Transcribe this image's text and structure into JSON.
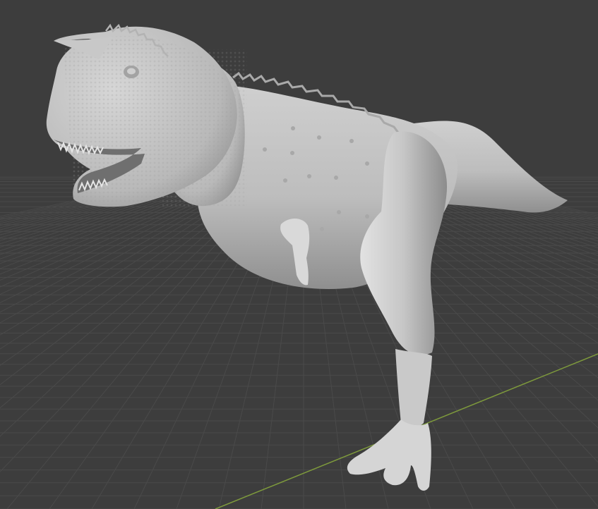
{
  "viewport": {
    "background_color": "#3d3d3d",
    "grid_line_color": "#4a4a4a",
    "x_axis_color": "#7e9a3c",
    "model_color": "#c4c4c4",
    "model_shadow_color": "#8a8a8a",
    "model_highlight_color": "#dedede"
  },
  "model": {
    "subject": "carnotaurus-sculpt",
    "shading": "solid-matcap"
  }
}
